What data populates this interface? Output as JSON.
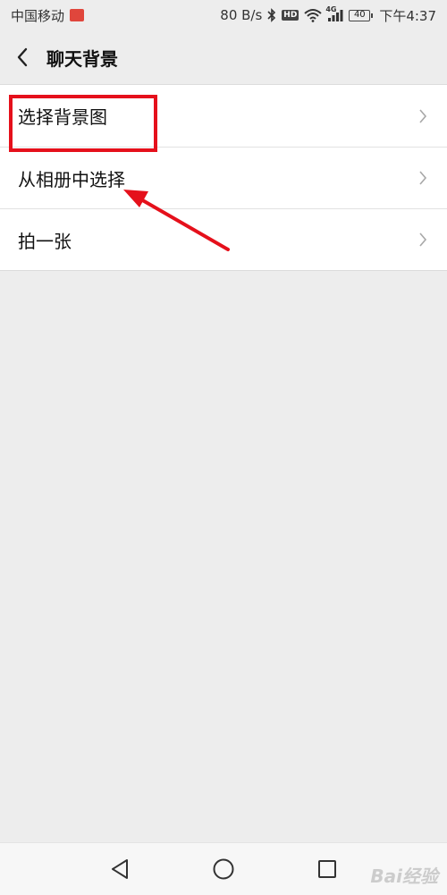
{
  "status_bar": {
    "carrier": "中国移动",
    "network_speed": "80 B/s",
    "hd_label": "HD",
    "network_type": "4G",
    "battery_level": "40",
    "time": "下午4:37"
  },
  "header": {
    "title": "聊天背景"
  },
  "list": {
    "items": [
      {
        "label": "选择背景图"
      },
      {
        "label": "从相册中选择"
      },
      {
        "label": "拍一张"
      }
    ]
  },
  "watermark": "Bai经验",
  "colors": {
    "background": "#ededed",
    "annotation": "#e5101b",
    "carrier_badge": "#e0463c"
  }
}
